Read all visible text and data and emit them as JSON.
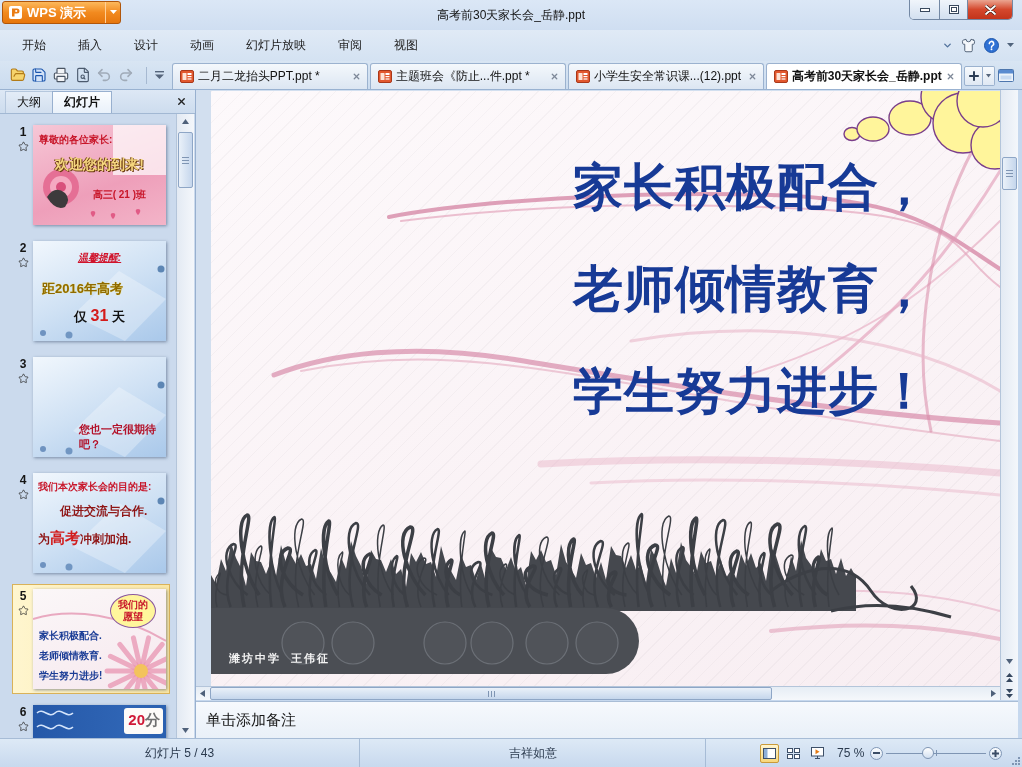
{
  "window": {
    "app_button": "WPS 演示",
    "title": "高考前30天家长会_岳静.ppt"
  },
  "menu": [
    "开始",
    "插入",
    "设计",
    "动画",
    "幻灯片放映",
    "审阅",
    "视图"
  ],
  "toolbar": [
    {
      "kind": "open",
      "disabled": false
    },
    {
      "kind": "save",
      "disabled": false
    },
    {
      "kind": "print",
      "disabled": false
    },
    {
      "kind": "preview",
      "disabled": false
    },
    {
      "kind": "undo",
      "disabled": true
    },
    {
      "kind": "redo",
      "disabled": true
    }
  ],
  "document_tabs": [
    {
      "label": "二月二龙抬头PPT.ppt *",
      "selected": false
    },
    {
      "label": "主题班会《防止...件.ppt *",
      "selected": false
    },
    {
      "label": "小学生安全常识课...(12).ppt",
      "selected": false
    },
    {
      "label": "高考前30天家长会_岳静.ppt",
      "selected": true
    }
  ],
  "panel": {
    "tabs": [
      {
        "label": "大纲",
        "selected": false
      },
      {
        "label": "幻灯片",
        "selected": true
      }
    ]
  },
  "thumbnails": [
    {
      "number": "1",
      "selected": false,
      "kind": "rose",
      "texts": [
        {
          "kind": "caption",
          "text": "尊敬的各位家长:"
        },
        {
          "kind": "title",
          "text": "欢迎您的到来!"
        },
        {
          "kind": "note",
          "text": "高三( 21 )班"
        }
      ]
    },
    {
      "number": "2",
      "selected": false,
      "kind": "glass",
      "texts": [
        {
          "kind": "alert",
          "text": "温馨提醒:"
        },
        {
          "kind": "banner",
          "text": "距2016年高考"
        },
        {
          "kind": "count",
          "text": "仅 **31** 天"
        }
      ]
    },
    {
      "number": "3",
      "selected": false,
      "kind": "glass",
      "texts": [
        {
          "kind": "question",
          "text": "您也一定很期待吧？"
        }
      ]
    },
    {
      "number": "4",
      "selected": false,
      "kind": "glass",
      "texts": [
        {
          "kind": "caption",
          "text": "我们本次家长会的目的是:"
        },
        {
          "kind": "heading",
          "text": "促进交流与合作."
        },
        {
          "kind": "heading",
          "text": "为**高考**冲刺加油."
        }
      ]
    },
    {
      "number": "5",
      "selected": true,
      "kind": "flower",
      "texts": [
        {
          "kind": "bubble",
          "text": "我们的愿望"
        },
        {
          "kind": "body",
          "text": "家长积极配合."
        },
        {
          "kind": "body",
          "text": "老师倾情教育."
        },
        {
          "kind": "body",
          "text": "学生努力进步!"
        }
      ]
    },
    {
      "number": "6",
      "selected": false,
      "kind": "lace",
      "texts": [
        {
          "kind": "score",
          "text": "**20**分"
        }
      ]
    }
  ],
  "slide": {
    "lines": [
      "家长积极配合，",
      "老师倾情教育，",
      "学生努力进步！"
    ],
    "footer": "潍坊中学  王伟征"
  },
  "notes": {
    "placeholder": "单击添加备注"
  },
  "status_bar": {
    "slide_counter": "幻灯片 5 / 43",
    "theme": "吉祥如意",
    "views": [
      {
        "kind": "normal",
        "selected": true
      },
      {
        "kind": "sorter",
        "selected": false
      },
      {
        "kind": "slideshow",
        "selected": false
      }
    ],
    "zoom": "75 %",
    "zoom_slider": {
      "level": 0.42
    }
  }
}
